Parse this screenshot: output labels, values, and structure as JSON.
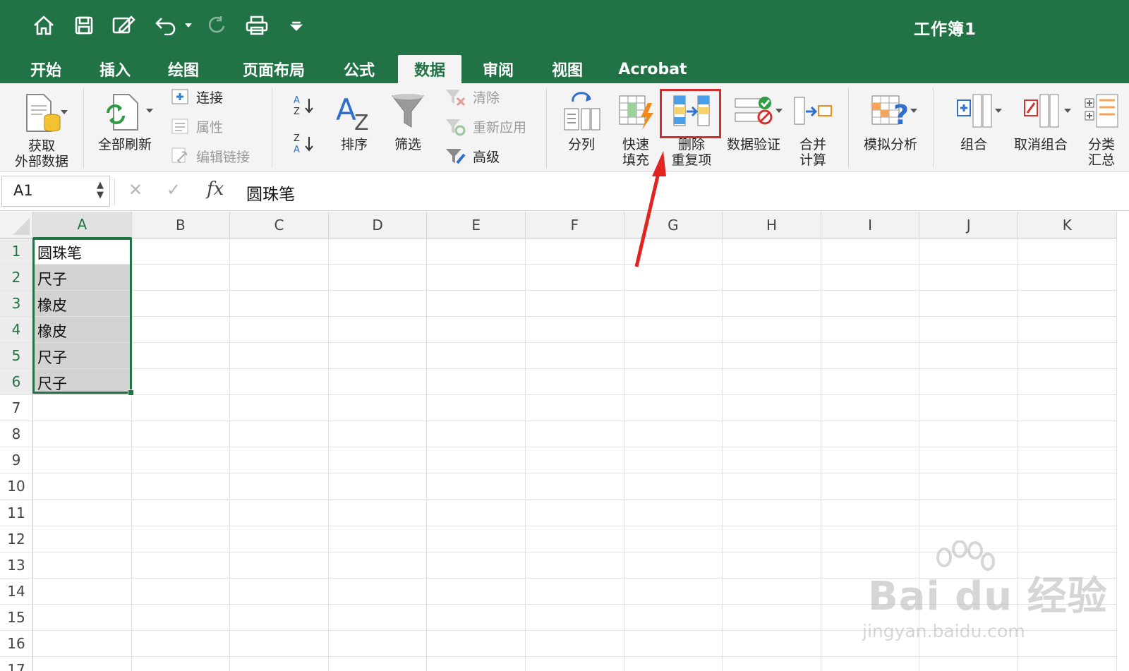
{
  "window": {
    "title": "工作簿1"
  },
  "quick_access": {
    "icons": [
      "home-icon",
      "save-icon",
      "edit-icon",
      "undo-icon",
      "redo-icon",
      "print-icon",
      "customize-icon"
    ]
  },
  "tabs": [
    {
      "label": "开始"
    },
    {
      "label": "插入"
    },
    {
      "label": "绘图"
    },
    {
      "label": "页面布局"
    },
    {
      "label": "公式"
    },
    {
      "label": "数据",
      "active": true
    },
    {
      "label": "审阅"
    },
    {
      "label": "视图"
    },
    {
      "label": "Acrobat"
    }
  ],
  "ribbon": {
    "get_data_l1": "获取",
    "get_data_l2": "外部数据",
    "refresh_all": "全部刷新",
    "connections": "连接",
    "properties": "属性",
    "edit_links": "编辑链接",
    "sort": "排序",
    "filter": "筛选",
    "clear": "清除",
    "reapply": "重新应用",
    "advanced": "高级",
    "text_to_columns": "分列",
    "flash_fill_l1": "快速",
    "flash_fill_l2": "填充",
    "remove_dup_l1": "删除",
    "remove_dup_l2": "重复项",
    "data_validation": "数据验证",
    "consolidate_l1": "合并",
    "consolidate_l2": "计算",
    "what_if": "模拟分析",
    "group": "组合",
    "ungroup": "取消组合",
    "subtotal_l1": "分类",
    "subtotal_l2": "汇总"
  },
  "formula_bar": {
    "name_box": "A1",
    "fx": "fx",
    "value": "圆珠笔"
  },
  "grid": {
    "columns": [
      "A",
      "B",
      "C",
      "D",
      "E",
      "F",
      "G",
      "H",
      "I",
      "J",
      "K"
    ],
    "rows": [
      "1",
      "2",
      "3",
      "4",
      "5",
      "6",
      "7",
      "8",
      "9",
      "10",
      "11",
      "12",
      "13",
      "14",
      "15",
      "16",
      "17"
    ],
    "column_a_values": [
      "圆珠笔",
      "尺子",
      "橡皮",
      "橡皮",
      "尺子",
      "尺子"
    ]
  },
  "watermark": {
    "main": "Bai du 经验",
    "sub": "jingyan.baidu.com"
  },
  "colors": {
    "excel_green": "#217346",
    "highlight_red": "#d62b2b"
  }
}
